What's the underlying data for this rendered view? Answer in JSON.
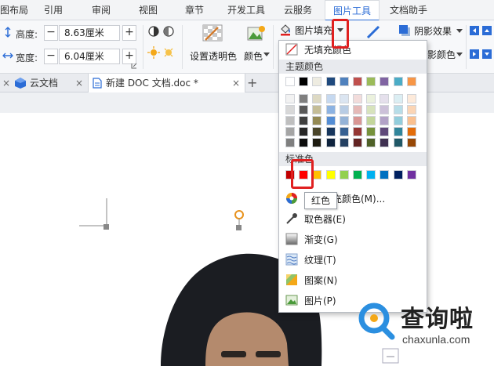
{
  "ribbon_tabs": [
    "图布局",
    "引用",
    "审阅",
    "视图",
    "章节",
    "开发工具",
    "云服务",
    "图片工具",
    "文档助手"
  ],
  "active_tab": "图片工具",
  "size": {
    "height_label": "高度:",
    "height_value": "8.63厘米",
    "width_label": "宽度:",
    "width_value": "6.04厘米",
    "minus": "−",
    "plus": "+"
  },
  "ribbon_buttons": {
    "set_transparent": "设置透明色",
    "color": "颜色",
    "picture_fill": "图片填充",
    "shadow_effect": "阴影效果",
    "shadow_color": "影颜色"
  },
  "doc_tabs": {
    "cloud": "云文档",
    "doc": "新建 DOC 文档.doc *",
    "add": "+",
    "close": "×"
  },
  "dropdown": {
    "no_fill": "无填充颜色",
    "theme_colors_header": "主题颜色",
    "standard_header": "标准色",
    "more_colors": "其他填充颜色(M)...",
    "eyedropper": "取色器(E)",
    "gradient": "渐变(G)",
    "texture": "纹理(T)",
    "pattern": "图案(N)",
    "picture": "图片(P)"
  },
  "tooltip": "红色",
  "colors": {
    "theme_top": [
      "#ffffff",
      "#000000",
      "#eeece1",
      "#1f497d",
      "#4f81bd",
      "#c0504d",
      "#9bbb59",
      "#8064a2",
      "#4bacc6",
      "#f79646"
    ],
    "theme_shades": [
      [
        "#f2f2f2",
        "#7f7f7f",
        "#ddd9c3",
        "#c6d9f0",
        "#dbe5f1",
        "#f2dcdb",
        "#ebf1dd",
        "#e5e0ec",
        "#dbeef3",
        "#fdeada"
      ],
      [
        "#d8d8d8",
        "#595959",
        "#c4bd97",
        "#8db3e2",
        "#b8cce4",
        "#e5b9b7",
        "#d7e3bc",
        "#ccc1d9",
        "#b7dde8",
        "#fbd5b5"
      ],
      [
        "#bfbfbf",
        "#3f3f3f",
        "#938953",
        "#548dd4",
        "#95b3d7",
        "#d99694",
        "#c3d69b",
        "#b2a2c7",
        "#92cddc",
        "#fac08f"
      ],
      [
        "#a5a5a5",
        "#262626",
        "#494429",
        "#17365d",
        "#366092",
        "#953734",
        "#76923c",
        "#5f497a",
        "#31859b",
        "#e36c09"
      ],
      [
        "#7f7f7f",
        "#0c0c0c",
        "#1d1b10",
        "#0f243e",
        "#244061",
        "#632423",
        "#4f6128",
        "#3f3151",
        "#205867",
        "#974806"
      ]
    ],
    "standard": [
      "#c00000",
      "#ff0000",
      "#ffc000",
      "#ffff00",
      "#92d050",
      "#00b050",
      "#00b0f0",
      "#0070c0",
      "#002060",
      "#7030a0"
    ],
    "accent": "#2b6cd6",
    "highlight": "#e02020"
  },
  "watermark": {
    "brand": "查询啦",
    "domain": "chaxunla.com"
  }
}
